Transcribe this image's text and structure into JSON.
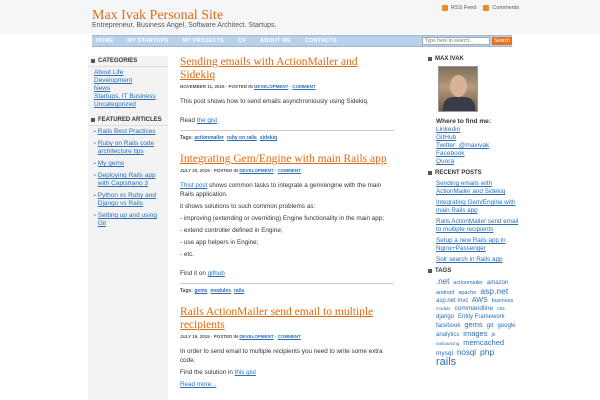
{
  "header": {
    "title": "Max Ivak Personal Site",
    "description": "Entrepreneur, Business Angel, Software Architect. Startups.",
    "rss_feed": "RSS Feed",
    "comments_feed": "Comments"
  },
  "nav": {
    "items": [
      "HOME",
      "MY STARTUPS",
      "MY PROJECTS",
      "CV",
      "ABOUT ME",
      "CONTACTS"
    ]
  },
  "search": {
    "placeholder": "Type here to search...",
    "button": "Search"
  },
  "left_sidebar": {
    "categories_title": "CATEGORIES",
    "categories": [
      "About Life",
      "Development",
      "News",
      "Startups, IT Business",
      "Uncategorized"
    ],
    "featured_title": "FEATURED ARTICLES",
    "featured": [
      "Rails Best Practices",
      "Ruby on Rails code architecture tips",
      "My gems",
      "Deploying Rails app with Capistrano 3",
      "Python vs Ruby and Django vs Rails",
      "Setting up and using Git"
    ]
  },
  "posts": [
    {
      "title": "Sending emails with ActionMailer and Sidekiq",
      "date": "NOVEMBER 11, 2015",
      "posted_in": "POSTED IN",
      "category": "DEVELOPMENT",
      "comment": "COMMENT",
      "body": [
        "This post shows how to send emails asynchroniously using Sidekiq."
      ],
      "read_prefix": "Read ",
      "read_link": "the gist",
      "tags_label": "Tags:",
      "tags": [
        "actionmailer",
        "ruby on rails",
        "sidekiq"
      ]
    },
    {
      "title": "Integrating Gem/Engine with main Rails app",
      "date": "JULY 20, 2015",
      "posted_in": "POSTED IN",
      "category": "DEVELOPMENT",
      "comment": "COMMENT",
      "intro_link": "Thist post",
      "intro_rest": " shows common tasks to integrate a gem/engine with the main Rails application.",
      "body": [
        "it shows solutions to such common problems as:",
        "- improving (extending or overriding) Engine functionality in the main app;",
        "- extend controller defined in Engine;",
        "- use app helpers in Engine;",
        "- etc."
      ],
      "find_prefix": "Find it on ",
      "find_link": "github",
      "tags_label": "Tags:",
      "tags": [
        "gems",
        "modules",
        "rails"
      ]
    },
    {
      "title": "Rails ActionMailer send email to multiple recipients",
      "date": "JULY 19, 2015",
      "posted_in": "POSTED IN",
      "category": "DEVELOPMENT",
      "comment": "COMMENT",
      "body": [
        "In order to send email to multiple recipients you need to write some extra code."
      ],
      "find_prefix": "Find the solution in ",
      "find_link": "this gist",
      "read_more": "Read more..."
    }
  ],
  "right_sidebar": {
    "author_title": "MAX IVAK",
    "where_title": "Where to find me:",
    "links": [
      "Linkedin",
      "GitHub",
      "Twitter: @maxivak",
      "Facebook",
      "Quora"
    ],
    "recent_title": "RECENT POSTS",
    "recent": [
      "Sending emails with ActionMailer and Sidekiq",
      "Integrating Gem/Engine with main Rails app",
      "Rails ActionMailer send email to multiple recipients",
      "Setup a new Rails app in Nginx+Passenger",
      "Solr search in Rails app"
    ],
    "tags_title": "TAGS",
    "tags": [
      ".net",
      "actionmailer",
      "amazon",
      "android",
      "apache",
      "asp.net",
      "asp.net mvc",
      "AWS",
      "business",
      "models",
      "commandline",
      "css",
      "django",
      "Entity Framework",
      "facebook",
      "gems",
      "git",
      "google",
      "analytics",
      "images",
      "js",
      "outsourcing",
      "memcached",
      "mysql",
      "nosql",
      "php",
      "rails"
    ]
  },
  "colors": {
    "accent": "#e06a10",
    "link": "#2a6fb5",
    "nav_bg": "#b9d0e8"
  }
}
